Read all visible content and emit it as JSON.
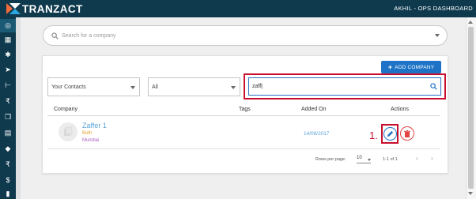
{
  "header": {
    "brand": "TRANZACT",
    "user_label": "AKHIL - OPS DASHBOARD"
  },
  "sidebar": {
    "items": [
      {
        "icon": "globe-icon",
        "glyph": "◎"
      },
      {
        "icon": "building-icon",
        "glyph": "▦"
      },
      {
        "icon": "settings-icon",
        "glyph": "✱"
      },
      {
        "icon": "send-icon",
        "glyph": "➤"
      },
      {
        "icon": "tree-icon",
        "glyph": "⊢"
      },
      {
        "icon": "rupee-icon",
        "glyph": "₹"
      },
      {
        "icon": "documents-icon",
        "glyph": "❐"
      },
      {
        "icon": "clipboard-icon",
        "glyph": "▤"
      },
      {
        "icon": "rocket-icon",
        "glyph": "◆"
      },
      {
        "icon": "currency-exchange-icon",
        "glyph": "₹"
      },
      {
        "icon": "dollar-tag-icon",
        "glyph": "$"
      },
      {
        "icon": "chart-icon",
        "glyph": "▮"
      }
    ]
  },
  "company_search": {
    "placeholder": "Search for a company"
  },
  "toolbar": {
    "add_company_label": "ADD COMPANY",
    "contacts_filter": "Your Contacts",
    "type_filter": "All",
    "search_value": "zaff|"
  },
  "table": {
    "headers": {
      "company": "Company",
      "tags": "Tags",
      "added_on": "Added On",
      "actions": "Actions"
    },
    "rows": [
      {
        "name": "Zaffer 1",
        "type": "Both",
        "city": "Mumbai",
        "added_on": "14/08/2017"
      }
    ]
  },
  "annotation": {
    "step": "1."
  },
  "pagination": {
    "rows_per_page_label": "Rows per page:",
    "rows_per_page": "10",
    "range": "1-1 of 1",
    "prev": "‹",
    "next": "›"
  },
  "colors": {
    "nav_bg": "#0f3a4e",
    "accent_blue": "#1e73c6",
    "highlight_red": "#c8102e",
    "link_blue": "#5aa5d8",
    "type_orange": "#e6a02e",
    "city_purple": "#b060c0"
  }
}
